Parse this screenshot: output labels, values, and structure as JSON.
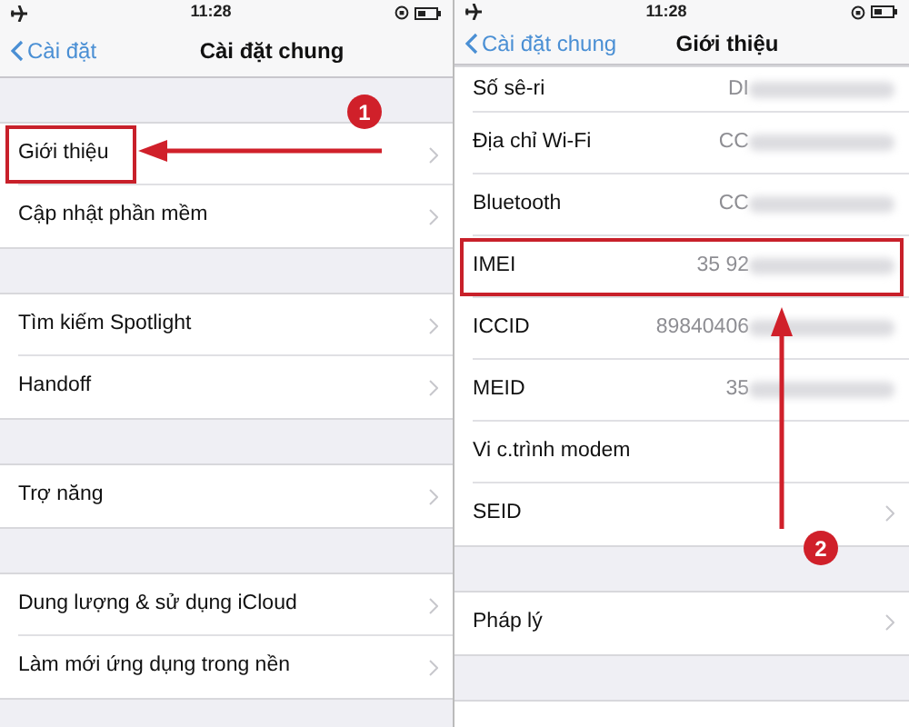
{
  "left_screen": {
    "status_bar": {
      "time": "11:28"
    },
    "nav": {
      "back": "Cài đặt",
      "title": "Cài đặt chung"
    },
    "groups": [
      [
        {
          "label": "Giới thiệu",
          "highlighted": true,
          "disclosure": true
        },
        {
          "label": "Cập nhật phần mềm",
          "highlighted": false,
          "disclosure": true
        }
      ],
      [
        {
          "label": "Tìm kiếm Spotlight",
          "highlighted": false,
          "disclosure": true
        },
        {
          "label": "Handoff",
          "highlighted": false,
          "disclosure": true
        }
      ],
      [
        {
          "label": "Trợ năng",
          "highlighted": false,
          "disclosure": true
        }
      ],
      [
        {
          "label": "Dung lượng & sử dụng iCloud",
          "highlighted": false,
          "disclosure": true
        },
        {
          "label": "Làm mới ứng dụng trong nền",
          "highlighted": false,
          "disclosure": true
        }
      ]
    ],
    "step_badge": "1"
  },
  "right_screen": {
    "status_bar": {
      "time": "11:28"
    },
    "nav": {
      "back": "Cài đặt chung",
      "title": "Giới thiệu"
    },
    "groups": [
      [
        {
          "label": "Số sê-ri",
          "value": "DI",
          "highlighted": false,
          "disclosure": false
        },
        {
          "label": "Địa chỉ Wi-Fi",
          "value": "CC",
          "highlighted": false,
          "disclosure": false
        },
        {
          "label": "Bluetooth",
          "value": "CC",
          "highlighted": false,
          "disclosure": false
        },
        {
          "label": "IMEI",
          "value": "35 92",
          "highlighted": true,
          "disclosure": false
        },
        {
          "label": "ICCID",
          "value": "89840406",
          "highlighted": false,
          "disclosure": false
        },
        {
          "label": "MEID",
          "value": "35",
          "highlighted": false,
          "disclosure": false
        },
        {
          "label": "Vi c.trình modem",
          "highlighted": false,
          "disclosure": false
        },
        {
          "label": "SEID",
          "highlighted": false,
          "disclosure": true
        }
      ],
      [
        {
          "label": "Pháp lý",
          "highlighted": false,
          "disclosure": true
        }
      ]
    ],
    "step_badge": "2"
  }
}
